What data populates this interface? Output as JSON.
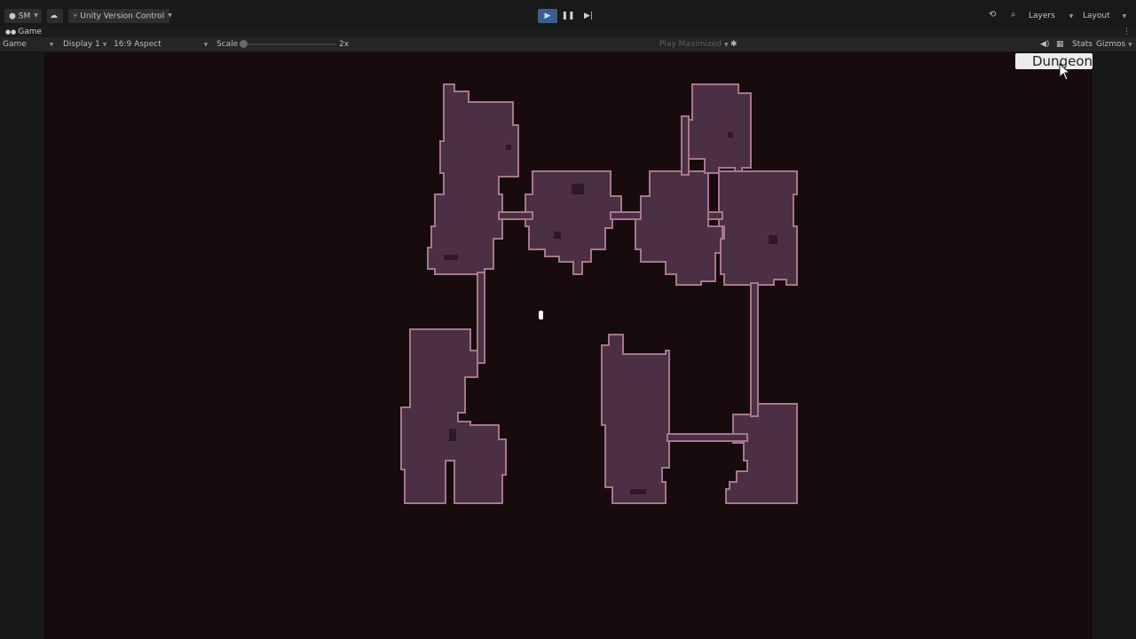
{
  "toolbar": {
    "account_label": "SM",
    "version_control_label": "Unity Version Control",
    "play_icon": "play-icon",
    "pause_icon": "pause-icon",
    "step_icon": "step-icon",
    "history_icon": "history-icon",
    "search_icon": "search-icon",
    "layers_label": "Layers",
    "layout_label": "Layout"
  },
  "tab": {
    "title": "Game",
    "menu_icon": "kebab-icon"
  },
  "game_bar": {
    "view_mode": "Game",
    "display": "Display 1",
    "aspect": "16:9 Aspect",
    "scale_label": "Scale",
    "scale_value": "2x",
    "play_mode": "Play Maximized",
    "stats_label": "Stats",
    "gizmos_label": "Gizmos"
  },
  "viewport": {
    "dungeon_button_label": "Dungeon",
    "background_color": "#170b0e",
    "room_fill_color": "#4a2f45",
    "room_edge_color": "#a8778c"
  },
  "colors": {
    "play_active": "#3a5f8f",
    "panel_bg": "#191919"
  }
}
